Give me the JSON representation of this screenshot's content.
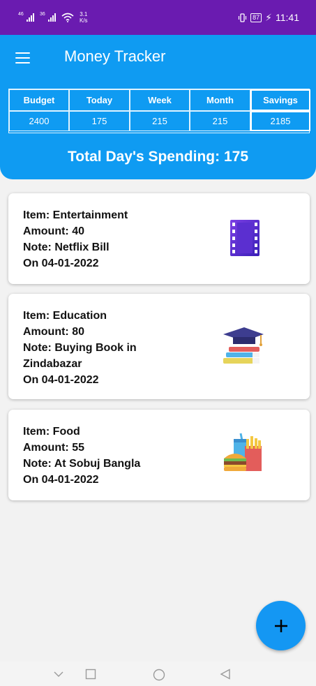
{
  "status_bar": {
    "signal1_tag": "46",
    "signal2_tag": "36",
    "speed_value": "3.1",
    "speed_unit": "K/s",
    "battery": "87",
    "time": "11:41"
  },
  "app_bar": {
    "title": "Money Tracker",
    "menu_icon": "hamburger-menu-icon"
  },
  "stats": {
    "headers": [
      "Budget",
      "Today",
      "Week",
      "Month",
      "Savings"
    ],
    "values": [
      "2400",
      "175",
      "215",
      "215",
      "2185"
    ]
  },
  "total_spending": "Total Day's Spending: 175",
  "entries": [
    {
      "item": "Item: Entertainment",
      "amount": "Amount: 40",
      "note": "Note: Netflix Bill",
      "date": "On 04-01-2022",
      "icon": "film-strip-icon"
    },
    {
      "item": "Item: Education",
      "amount": "Amount: 80",
      "note_line1": "Note: Buying Book in",
      "note_line2": "Zindabazar",
      "date": "On 04-01-2022",
      "icon": "graduation-books-icon"
    },
    {
      "item": "Item: Food",
      "amount": "Amount: 55",
      "note": "Note: At Sobuj Bangla",
      "date": "On 04-01-2022",
      "icon": "fast-food-icon"
    }
  ],
  "colors": {
    "status_bar": "#6a1bb0",
    "primary": "#0f9bf2",
    "fab": "#1497f3",
    "background": "#f2f2f2"
  }
}
